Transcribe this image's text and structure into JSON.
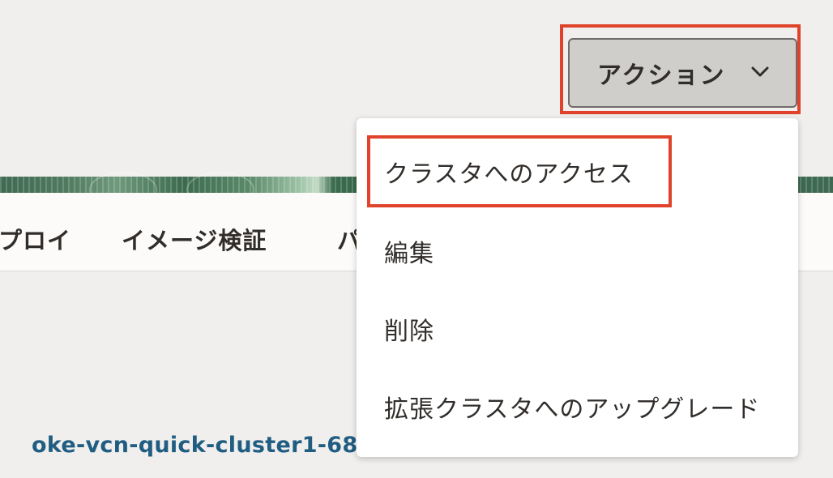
{
  "tabs": [
    {
      "label": "プロイ"
    },
    {
      "label": "イメージ検証"
    },
    {
      "label": "パ"
    }
  ],
  "content": {
    "cluster_link": "oke-vcn-quick-cluster1-68"
  },
  "actions": {
    "label": "アクション",
    "chevron": "chevron-down-icon"
  },
  "menu": {
    "items": [
      {
        "label": "クラスタへのアクセス",
        "highlighted": true
      },
      {
        "label": "編集"
      },
      {
        "label": "削除"
      },
      {
        "label": "拡張クラスタへのアップグレード"
      }
    ]
  },
  "colors": {
    "highlight": "#e0432c",
    "link": "#1f5d82",
    "button_bg": "#d0ceca",
    "banner": "#3f6a52"
  }
}
